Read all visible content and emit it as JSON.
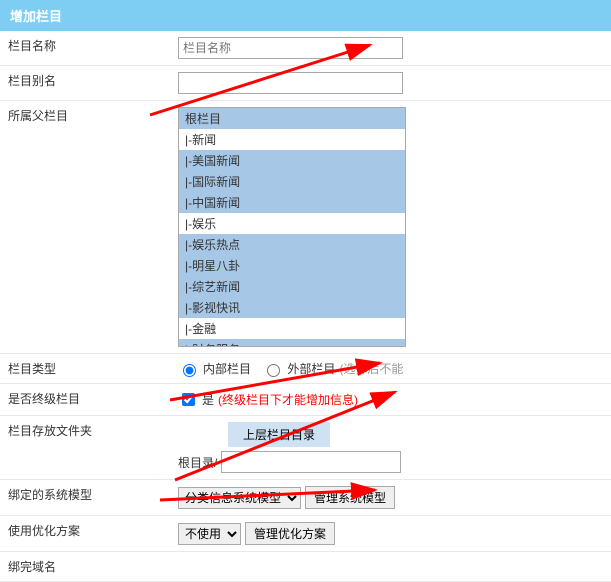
{
  "header": "增加栏目",
  "rows": {
    "name_label": "栏目名称",
    "name_placeholder": "栏目名称",
    "alias_label": "栏目别名",
    "parent_label": "所属父栏目",
    "type_label": "栏目类型",
    "type_internal": "内部栏目",
    "type_external": "外部栏目",
    "type_hint": "(选择后不能",
    "final_label": "是否终级栏目",
    "final_yes": "是",
    "final_hint": "(终级栏目下才能增加信息)",
    "folder_label": "栏目存放文件夹",
    "folder_btn": "上层栏目目录",
    "folder_prefix": "根目录/",
    "model_label": "绑定的系统模型",
    "model_select": "分类信息系统模型",
    "model_btn": "管理系统模型",
    "optimize_label": "使用优化方案",
    "optimize_select": "不使用",
    "optimize_btn": "管理优化方案",
    "domain_label": "绑完域名"
  },
  "listbox": [
    {
      "label": "根栏目",
      "sel": true
    },
    {
      "label": "|-新闻",
      "sel": false
    },
    {
      "label": "  |-美国新闻",
      "sel": true
    },
    {
      "label": "  |-国际新闻",
      "sel": true
    },
    {
      "label": "  |-中国新闻",
      "sel": true
    },
    {
      "label": "|-娱乐",
      "sel": false
    },
    {
      "label": "  |-娱乐热点",
      "sel": true
    },
    {
      "label": "  |-明星八卦",
      "sel": true
    },
    {
      "label": "  |-综艺新闻",
      "sel": true
    },
    {
      "label": "  |-影视快讯",
      "sel": true
    },
    {
      "label": "|-金融",
      "sel": false
    },
    {
      "label": "  |-财务服务",
      "sel": true
    }
  ]
}
